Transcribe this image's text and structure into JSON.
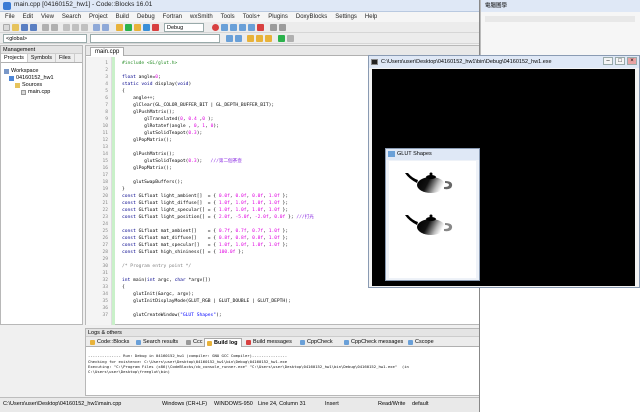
{
  "main_window": {
    "title": "main.cpp [04160152_hw1] - Code::Blocks 16.01",
    "menu": [
      "File",
      "Edit",
      "View",
      "Search",
      "Project",
      "Build",
      "Debug",
      "Fortran",
      "wxSmith",
      "Tools",
      "Tools+",
      "Plugins",
      "DoxyBlocks",
      "Settings",
      "Help"
    ],
    "toolbar": {
      "build_target": "Debug",
      "scope_combo": "<global>"
    }
  },
  "management": {
    "header": "Management",
    "tabs": [
      "Projects",
      "Symbols",
      "Files"
    ],
    "tree": {
      "workspace": "Workspace",
      "project": "04160152_hw1",
      "folder": "Sources",
      "file": "main.cpp"
    }
  },
  "editor": {
    "tab": "main.cpp",
    "lines": [
      {
        "n": "1",
        "t": "#include <GL/glut.h>"
      },
      {
        "n": "2",
        "t": ""
      },
      {
        "n": "3",
        "t": "float angle=0;"
      },
      {
        "n": "4",
        "t": "static void display(void)"
      },
      {
        "n": "5",
        "t": "{"
      },
      {
        "n": "6",
        "t": "    angle++;"
      },
      {
        "n": "7",
        "t": "    glClear(GL_COLOR_BUFFER_BIT | GL_DEPTH_BUFFER_BIT);"
      },
      {
        "n": "8",
        "t": "    glPushMatrix();"
      },
      {
        "n": "9",
        "t": "        glTranslated(0, 0.4 ,0 );"
      },
      {
        "n": "10",
        "t": "        glRotatef(angle , 0, 1, 0);"
      },
      {
        "n": "11",
        "t": "        glutSolidTeapot(0.3);"
      },
      {
        "n": "12",
        "t": "    glPopMatrix();"
      },
      {
        "n": "13",
        "t": ""
      },
      {
        "n": "14",
        "t": "    glPushMatrix();"
      },
      {
        "n": "15",
        "t": "        glutSolidTeapot(0.3);   ///第二個茶壺"
      },
      {
        "n": "16",
        "t": "    glPopMatrix();"
      },
      {
        "n": "17",
        "t": ""
      },
      {
        "n": "18",
        "t": "    glutSwapBuffers();"
      },
      {
        "n": "19",
        "t": "}"
      },
      {
        "n": "20",
        "t": "const GLfloat light_ambient[]  = { 0.0f, 0.0f, 0.0f, 1.0f };"
      },
      {
        "n": "21",
        "t": "const GLfloat light_diffuse[]  = { 1.0f, 1.0f, 1.0f, 1.0f };"
      },
      {
        "n": "22",
        "t": "const GLfloat light_specular[] = { 1.0f, 1.0f, 1.0f, 1.0f };"
      },
      {
        "n": "23",
        "t": "const GLfloat light_position[] = { 2.0f, -5.0f, -2.0f, 0.0f }; ///打光"
      },
      {
        "n": "24",
        "t": ""
      },
      {
        "n": "25",
        "t": "const GLfloat mat_ambient[]    = { 0.7f, 0.7f, 0.7f, 1.0f };"
      },
      {
        "n": "26",
        "t": "const GLfloat mat_diffuse[]    = { 0.8f, 0.8f, 0.8f, 1.0f };"
      },
      {
        "n": "27",
        "t": "const GLfloat mat_specular[]   = { 1.0f, 1.0f, 1.0f, 1.0f };"
      },
      {
        "n": "28",
        "t": "const GLfloat high_shininess[] = { 100.0f };"
      },
      {
        "n": "29",
        "t": ""
      },
      {
        "n": "30",
        "t": "/* Program entry point */"
      },
      {
        "n": "31",
        "t": ""
      },
      {
        "n": "32",
        "t": "int main(int argc, char *argv[])"
      },
      {
        "n": "33",
        "t": "{"
      },
      {
        "n": "34",
        "t": "    glutInit(&argc, argv);"
      },
      {
        "n": "35",
        "t": "    glutInitDisplayMode(GLUT_RGB | GLUT_DOUBLE | GLUT_DEPTH);"
      },
      {
        "n": "36",
        "t": ""
      },
      {
        "n": "37",
        "t": "    glutCreateWindow(\"GLUT Shapes\");"
      }
    ]
  },
  "logs": {
    "header": "Logs & others",
    "tabs": [
      "Code::Blocks",
      "Search results",
      "Ccc",
      "Build log",
      "Build messages",
      "CppCheck",
      "CppCheck messages",
      "Cscope"
    ],
    "active_tab": "Build log",
    "lines": [
      "-------------- Run: Debug in 04160152_hw1 (compiler: GNU GCC Compiler)---------------",
      "Checking for existence: C:\\Users\\user\\Desktop\\04160152_hw1\\bin\\Debug\\04160152_hw1.exe",
      "Executing: \"C:\\Program Files (x86)\\CodeBlocks/cb_console_runner.exe\" \"C:\\Users\\user\\Desktop\\04160152_hw1\\bin\\Debug\\04160152_hw1.exe\"  (in",
      "C:\\Users\\user\\Desktop\\freeglut\\bin)"
    ]
  },
  "statusbar": {
    "path": "C:\\Users\\user\\Desktop\\04160152_hw1\\main.cpp",
    "eol": "Windows (CR+LF)",
    "encoding": "WINDOWS-950",
    "position": "Line 24, Column 31",
    "mode": "Insert",
    "access": "Read/Write",
    "profile": "default"
  },
  "console_window": {
    "title": "C:\\Users\\user\\Desktop\\04160152_hw1\\bin\\Debug\\04160152_hw1.exe"
  },
  "glut_window": {
    "title": "GLUT Shapes"
  },
  "side_window": {
    "title": "電腦圖學"
  }
}
